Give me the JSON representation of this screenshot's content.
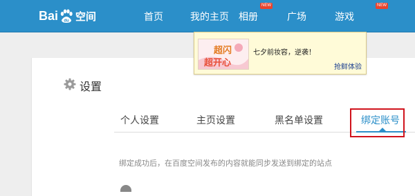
{
  "logo": {
    "text_left": "Bai",
    "text_paw": "du",
    "text_right": "空间"
  },
  "nav": {
    "items": [
      {
        "label": "首页"
      },
      {
        "label": "我的主页"
      },
      {
        "label": "相册",
        "badge": "NEW"
      },
      {
        "label": "广场"
      },
      {
        "label": "游戏",
        "badge": "NEW"
      }
    ]
  },
  "promo": {
    "image_text": "超闪 超开心",
    "text": "七夕前妆容，逆袭！",
    "link": "抢鲜体验"
  },
  "settings": {
    "title": "设置",
    "tabs": [
      {
        "label": "个人设置"
      },
      {
        "label": "主页设置"
      },
      {
        "label": "黑名单设置"
      },
      {
        "label": "绑定账号",
        "active": true
      }
    ],
    "description": "绑定成功后，在百度空间发布的内容就能同步发送到绑定的站点"
  },
  "colors": {
    "brand": "#2b8fc9",
    "highlight": "#d0121b",
    "promo_bg": "#fffbd8"
  }
}
